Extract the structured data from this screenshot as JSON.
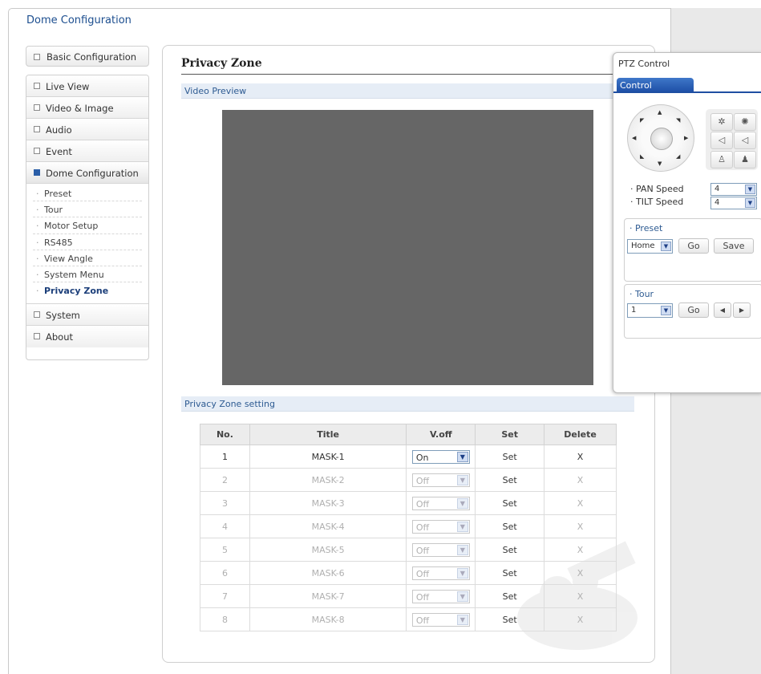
{
  "app_title": "Dome Configuration",
  "sidebar": {
    "basic": "Basic Configuration",
    "items": [
      {
        "label": "Live View"
      },
      {
        "label": "Video & Image"
      },
      {
        "label": "Audio"
      },
      {
        "label": "Event"
      },
      {
        "label": "Dome Configuration"
      }
    ],
    "sub_items": [
      "Preset",
      "Tour",
      "Motor Setup",
      "RS485",
      "View Angle",
      "System Menu",
      "Privacy Zone"
    ],
    "bottom_items": [
      "System",
      "About"
    ]
  },
  "main": {
    "title": "Privacy Zone",
    "video_preview_label": "Video Preview",
    "setting_label": "Privacy Zone setting",
    "table": {
      "headers": [
        "No.",
        "Title",
        "V.off",
        "Set",
        "Delete"
      ],
      "rows": [
        {
          "no": "1",
          "title": "MASK-1",
          "voff": "On",
          "set": "Set",
          "del": "X"
        },
        {
          "no": "2",
          "title": "MASK-2",
          "voff": "Off",
          "set": "Set",
          "del": "X"
        },
        {
          "no": "3",
          "title": "MASK-3",
          "voff": "Off",
          "set": "Set",
          "del": "X"
        },
        {
          "no": "4",
          "title": "MASK-4",
          "voff": "Off",
          "set": "Set",
          "del": "X"
        },
        {
          "no": "5",
          "title": "MASK-5",
          "voff": "Off",
          "set": "Set",
          "del": "X"
        },
        {
          "no": "6",
          "title": "MASK-6",
          "voff": "Off",
          "set": "Set",
          "del": "X"
        },
        {
          "no": "7",
          "title": "MASK-7",
          "voff": "Off",
          "set": "Set",
          "del": "X"
        },
        {
          "no": "8",
          "title": "MASK-8",
          "voff": "Off",
          "set": "Set",
          "del": "X"
        }
      ]
    }
  },
  "ptz": {
    "title": "PTZ Control",
    "tab": "Control",
    "pan_label": "· PAN Speed",
    "pan_value": "4",
    "tilt_label": "· TILT Speed",
    "tilt_value": "4",
    "preset_label": "· Preset",
    "preset_value": "Home",
    "go_label": "Go",
    "save_label": "Save",
    "tour_label": "· Tour",
    "tour_value": "1",
    "tour_go_label": "Go"
  },
  "colors": {
    "accent": "#1f4fa2",
    "video_bg": "#666666",
    "section_bar": "#e6edf6"
  }
}
